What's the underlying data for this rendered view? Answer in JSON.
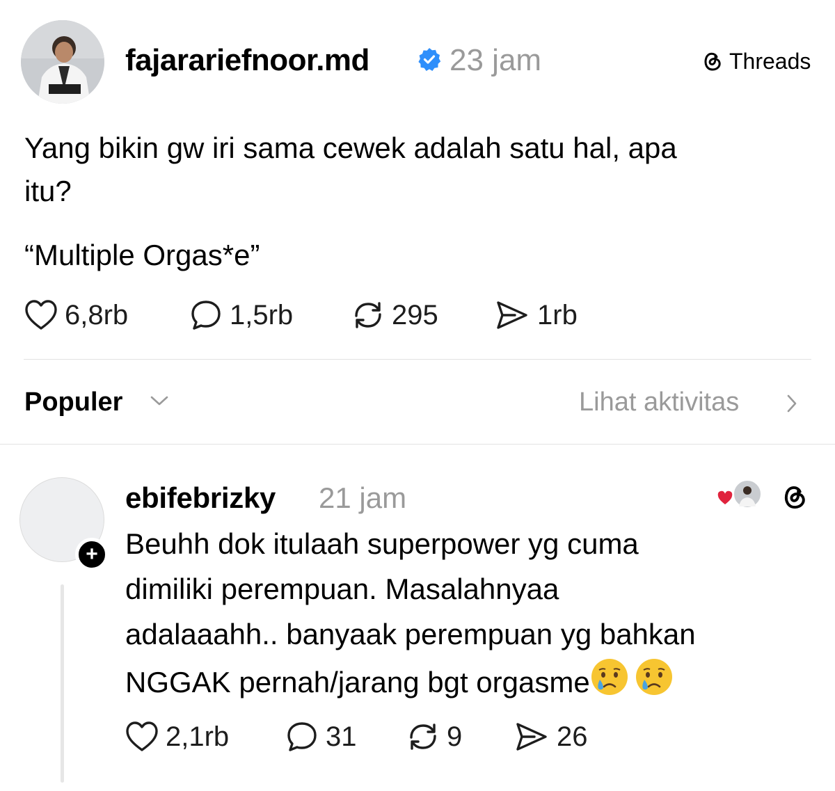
{
  "post": {
    "username": "fajarariefnoor.md",
    "time": "23 jam",
    "source_label": "Threads",
    "text_line1": "Yang bikin gw iri sama cewek adalah satu hal, apa",
    "text_line2": "itu?",
    "text_line3": "“Multiple Orgas*e”",
    "stats": {
      "likes": "6,8rb",
      "replies": "1,5rb",
      "reposts": "295",
      "shares": "1rb"
    }
  },
  "filter": {
    "sort_label": "Populer",
    "activity_label": "Lihat aktivitas"
  },
  "reply": {
    "username": "ebifebrizky",
    "time": "21 jam",
    "text_line1": "Beuhh dok itulaah superpower yg cuma",
    "text_line2": "dimiliki perempuan. Masalahnyaa",
    "text_line3": "adalaaahh.. banyaak perempuan yg bahkan",
    "text_line4": "NGGAK pernah/jarang bgt orgasme",
    "stats": {
      "likes": "2,1rb",
      "replies": "31",
      "reposts": "9",
      "shares": "26"
    }
  },
  "icons": [
    "verified-badge-icon",
    "threads-logo-icon",
    "heart-icon",
    "comment-icon",
    "repost-icon",
    "share-icon",
    "chevron-down-icon",
    "chevron-right-icon",
    "plus-icon",
    "crying-face-emoji"
  ],
  "colors": {
    "verified": "#2f8ffb",
    "muted_text": "#9a9a9a",
    "divider": "#e2e2e2",
    "like_heart": "#e0233d"
  }
}
